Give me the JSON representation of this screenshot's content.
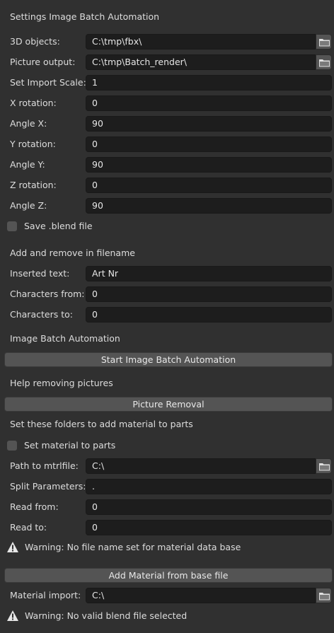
{
  "panel": {
    "title": "Settings Image Batch Automation"
  },
  "settings": {
    "objects_label": "3D objects:",
    "objects_value": "C:\\tmp\\fbx\\",
    "output_label": "Picture output:",
    "output_value": "C:\\tmp\\Batch_render\\",
    "scale_label": "Set Import Scale:",
    "scale_value": "1",
    "xrot_label": "X rotation:",
    "xrot_value": "0",
    "anglex_label": "Angle X:",
    "anglex_value": "90",
    "yrot_label": "Y rotation:",
    "yrot_value": "0",
    "angley_label": "Angle Y:",
    "angley_value": "90",
    "zrot_label": "Z rotation:",
    "zrot_value": "0",
    "anglez_label": "Angle Z:",
    "anglez_value": "90",
    "save_blend_label": "Save .blend file",
    "save_blend_checked": false
  },
  "filename": {
    "heading": "Add and remove in filename",
    "inserted_label": "Inserted text:",
    "inserted_value": "Art Nr",
    "from_label": "Characters from:",
    "from_value": "0",
    "to_label": "Characters to:",
    "to_value": "0"
  },
  "automation": {
    "heading": "Image Batch Automation",
    "start_button": "Start Image Batch Automation"
  },
  "removal": {
    "heading": "Help removing pictures",
    "button": "Picture Removal"
  },
  "material": {
    "heading": "Set these folders to add material to parts",
    "set_label": "Set material to parts",
    "set_checked": false,
    "path_label": "Path to mtrlfile:",
    "path_value": "C:\\",
    "split_label": "Split Parameters:",
    "split_value": ".",
    "read_from_label": "Read from:",
    "read_from_value": "0",
    "read_to_label": "Read to:",
    "read_to_value": "0",
    "warning1": "Warning: No file name set for material data base",
    "add_button": "Add Material from base file",
    "import_label": "Material import:",
    "import_value": "C:\\",
    "warning2": "Warning: No valid blend file selected"
  },
  "colors": {
    "background": "#303030",
    "field": "#1d1d1d",
    "button": "#545454",
    "text": "#dddddd"
  },
  "icons": [
    "folder-icon",
    "warning-icon"
  ]
}
